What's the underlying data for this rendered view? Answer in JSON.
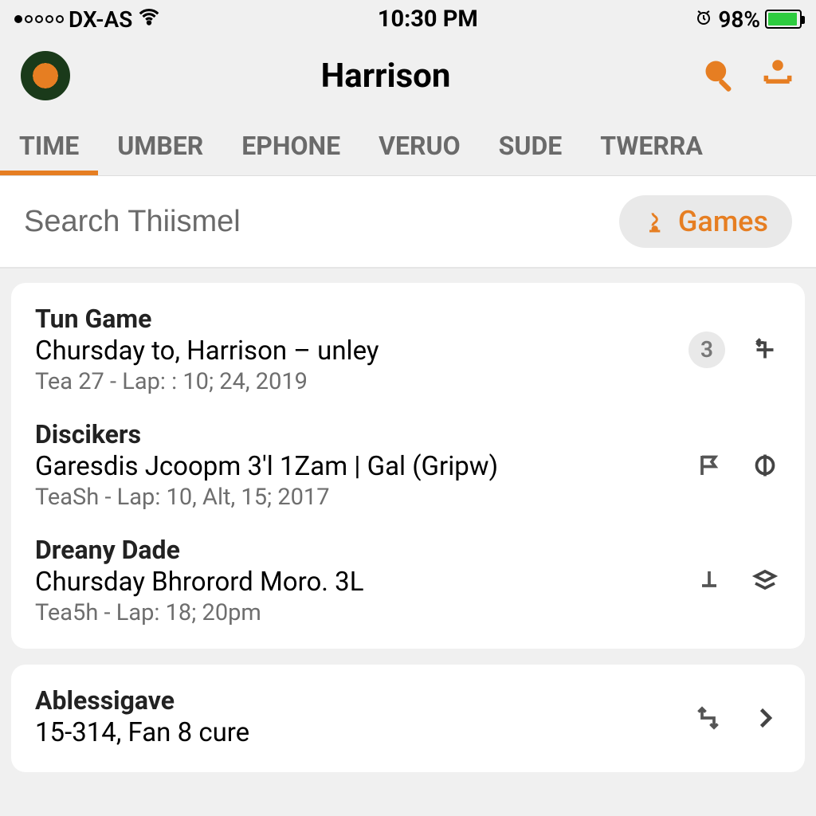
{
  "status_bar": {
    "carrier": "DX-AS",
    "time": "10:30 PM",
    "battery_pct": "98%"
  },
  "header": {
    "title": "Harrison"
  },
  "tabs": [
    {
      "label": "TIME",
      "active": true
    },
    {
      "label": "UMBER",
      "active": false
    },
    {
      "label": "EPHONE",
      "active": false
    },
    {
      "label": "VERUO",
      "active": false
    },
    {
      "label": "SUDE",
      "active": false
    },
    {
      "label": "TWERRA",
      "active": false
    }
  ],
  "search": {
    "placeholder": "Search Thiismel"
  },
  "filter_pill": {
    "label": "Games"
  },
  "list_card1": [
    {
      "title": "Tun Game",
      "sub": "Chursday to, Harrison – unley",
      "meta": "Tea 27 - Lap: : 10; 24, 2019",
      "badge": "3"
    },
    {
      "title": "Discikers",
      "sub": "Garesdis Jcoopm 3'l 1Zam | Gal (Gripw)",
      "meta": "TeaSh - Lap: 10, Alt, 15; 2017",
      "badge": null
    },
    {
      "title": "Dreany Dade",
      "sub": "Chursday Bhrorord Moro. 3L",
      "meta": "Tea5h - Lap: 18; 20pm",
      "badge": null
    }
  ],
  "list_card2": [
    {
      "title": "Ablessigave",
      "sub": "15-314, Fan 8 cure",
      "meta": "",
      "badge": null
    }
  ]
}
